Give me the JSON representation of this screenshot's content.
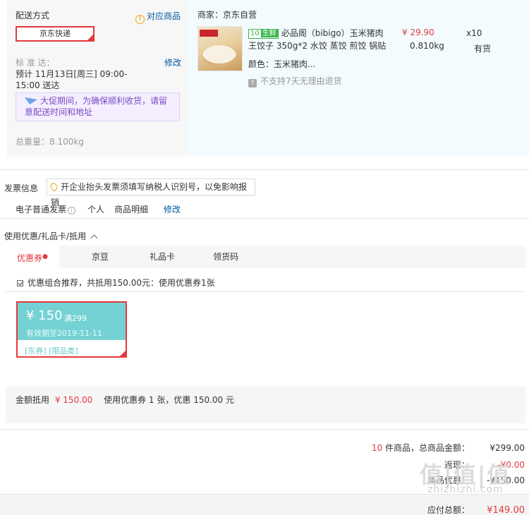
{
  "shipping": {
    "title": "配送方式",
    "related_link": "对应商品",
    "mode": "京东快递",
    "std_label": "标 准 达：",
    "edit": "修改",
    "date_line1": "预计 11月13日[周三] 09:00-",
    "date_line2": "15:00 送达",
    "promo_line1": "大促期间，为确保顺利收货，请留",
    "promo_line2": "意配送时间和地址",
    "weight": "总重量：8.100kg"
  },
  "item": {
    "merchant": "商家：京东自营",
    "badge_a": "10",
    "badge_b": "生鲜",
    "name_line1": "必品阁（bibigo）玉米猪肉",
    "name_line2": "王饺子 350g*2 水饺 蒸饺 煎饺 锅贴",
    "price": "¥ 29.90",
    "qty": "x10",
    "weight": "0.810kg",
    "stock": "有货",
    "color": "颜色：玉米猪肉...",
    "return_note": "不支持7天无理由退货"
  },
  "invoice": {
    "title": "发票信息",
    "tip": "开企业抬头发票须填写纳税人识别号，以免影响报销",
    "type": "电子普通发票",
    "owner": "个人",
    "content": "商品明细",
    "edit": "修改"
  },
  "discount": {
    "title": "使用优惠/礼品卡/抵用",
    "tabs": [
      {
        "label": "优惠券"
      },
      {
        "label": "京豆"
      },
      {
        "label": "礼品卡"
      },
      {
        "label": "领货码"
      }
    ],
    "recommend": "优惠组合推荐，共抵用150.00元：使用优惠券1张",
    "coupon": {
      "amount": "¥ 150",
      "condition": "满299",
      "expiry": "有效期至2019-11-11",
      "kinds": "[东券]  [限品类]"
    },
    "offset_label": "金额抵用",
    "offset_value": "¥ 150.00",
    "offset_desc": "使用优惠券 1 张，优惠 150.00 元"
  },
  "summary": {
    "count": "10",
    "count_suffix": " 件商品，总商品金额：",
    "total": "¥299.00",
    "row2_label": "返现：",
    "row2_value": "-¥0.00",
    "row3_label": "商品优惠：",
    "row3_value": "-¥150.00",
    "pay_label": "应付总额：",
    "pay_value": "¥149.00"
  },
  "watermark": {
    "main": "值|值|值",
    "sub": "zhizhizhi.com"
  }
}
